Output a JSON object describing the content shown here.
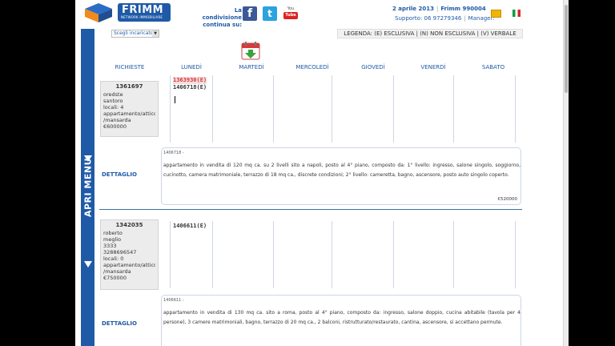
{
  "header": {
    "logo_brand": "FRIMM",
    "logo_sub": "NETWORK IMMOBILIARE",
    "share_text": "La condivisione continua su:",
    "youtube_label": "You",
    "youtube_tube": "Tube",
    "date": "2 aprile 2013",
    "account": "Frimm 990004",
    "support": "Supporto: 06 97279346",
    "manager": "Manager:"
  },
  "sidebar": {
    "apri_menu": "APRI MENU"
  },
  "toolbar": {
    "select_value": "Scegli incaricato",
    "legend": "LEGENDA: (E) ESCLUSIVA | (N) NON ESCLUSIVA | (V) VERBALE"
  },
  "columns": [
    "RICHIESTE",
    "LUNEDÌ",
    "MARTEDÌ",
    "MERCOLEDÌ",
    "GIOVEDÌ",
    "VENERDÌ",
    "SABATO"
  ],
  "requests": [
    {
      "code": "1361697",
      "lines": [
        "oredste",
        "santoro",
        "locali: 4",
        "appartamento/attico",
        "/mansarda",
        "€600000"
      ],
      "monday": [
        {
          "text": "1363930(E)",
          "highlight": true
        },
        {
          "text": "1406718(E)",
          "highlight": false
        }
      ],
      "detail_label": "DETTAGLIO",
      "detail_ref": "1406718 -",
      "detail_text": "appartamento in vendita di 120 mq ca. su 2 livelli sito a napoli, posto al 4° piano, composto da: 1° livello: ingresso, salone singolo, soggiorno, cucinotto, camera matrimoniale, terrazzo di 18 mq ca., discrete condizioni; 2° livello: cameretta, bagno, ascensore, posto auto singolo coperto.",
      "detail_price": "€520000"
    },
    {
      "code": "1342035",
      "lines": [
        "roberto",
        "meglio",
        "3333",
        "3288696547",
        "locali: 0",
        "appartamento/attico",
        "/mansarda",
        "€750000"
      ],
      "monday": [
        {
          "text": "1406611(E)",
          "highlight": false
        }
      ],
      "detail_label": "DETTAGLIO",
      "detail_ref": "1406611 -",
      "detail_text": "appartamento in vendita di 130 mq ca. sito a roma, posto al 4° piano, composto da: ingresso, salone doppio, cucina abitabile (tavola per 4 persone), 3 camere matrimoniali, bagno, terrazzo di 20 mq ca., 2 balconi, ristrutturato/restaurato, cantina, ascensore, si accettano permute.",
      "detail_price": ""
    }
  ],
  "colors": {
    "brand_blue": "#1f5aa7",
    "highlight_red": "#d43c3c"
  }
}
